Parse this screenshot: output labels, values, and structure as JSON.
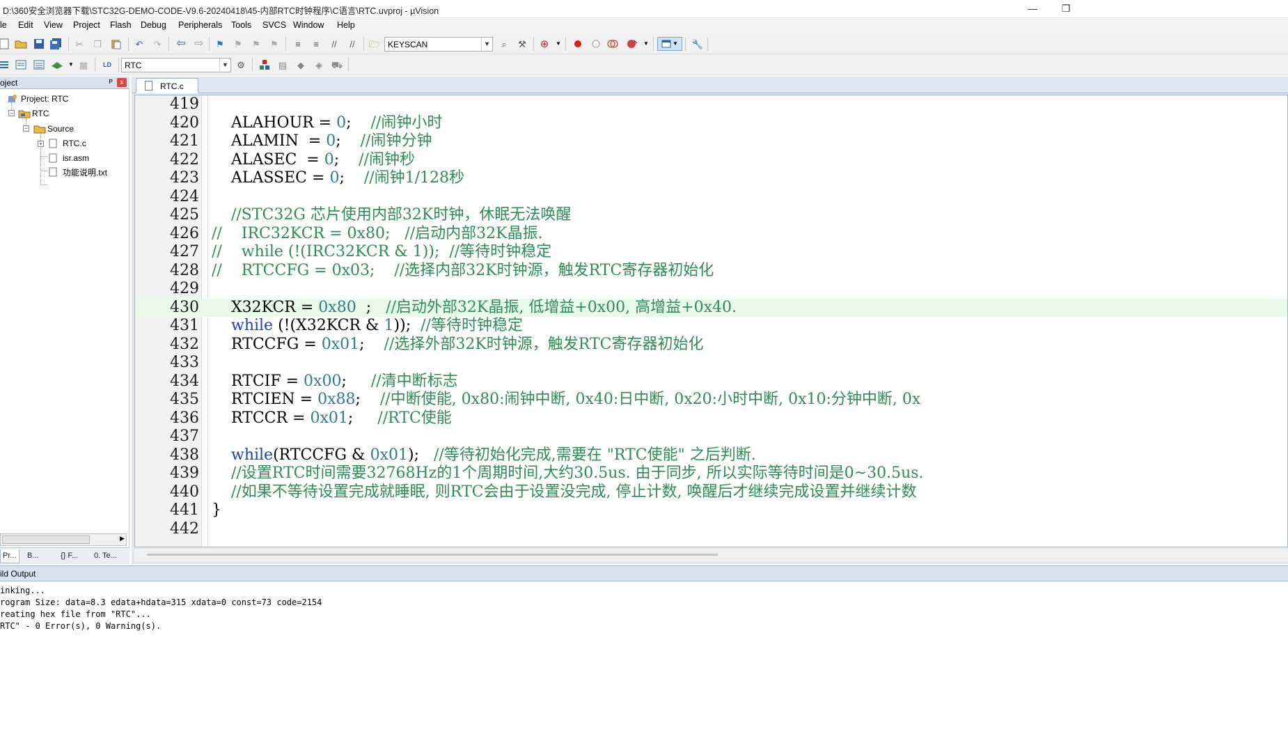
{
  "window": {
    "title": "D:\\360安全浏览器下载\\STC32G-DEMO-CODE-V9.6-20240418\\45-内部RTC时钟程序\\C语言\\RTC.uvproj - µVision",
    "minimize": "—",
    "restore": "❐"
  },
  "menu": [
    "le",
    "Edit",
    "View",
    "Project",
    "Flash",
    "Debug",
    "Peripherals",
    "Tools",
    "SVCS",
    "Window",
    "Help"
  ],
  "toolbar": {
    "find_combo": "KEYSCAN",
    "target_combo": "RTC"
  },
  "project_panel": {
    "title": "oject",
    "pin": "ᴘ",
    "close": "x",
    "root": "Project: RTC",
    "target": "RTC",
    "group": "Source",
    "files": [
      "RTC.c",
      "isr.asm",
      "功能说明.txt"
    ],
    "tabs": [
      "Pr...",
      "B...",
      "{} F...",
      "0. Te..."
    ]
  },
  "editor": {
    "tab": "RTC.c",
    "lines": [
      {
        "n": "419",
        "segs": []
      },
      {
        "n": "420",
        "segs": [
          [
            "t",
            "    ALAHOUR = "
          ],
          [
            "n",
            "0"
          ],
          [
            "t",
            ";    "
          ],
          [
            "c",
            "//闹钟小时"
          ]
        ]
      },
      {
        "n": "421",
        "segs": [
          [
            "t",
            "    ALAMIN  = "
          ],
          [
            "n",
            "0"
          ],
          [
            "t",
            ";    "
          ],
          [
            "c",
            "//闹钟分钟"
          ]
        ]
      },
      {
        "n": "422",
        "segs": [
          [
            "t",
            "    ALASEC  = "
          ],
          [
            "n",
            "0"
          ],
          [
            "t",
            ";    "
          ],
          [
            "c",
            "//闹钟秒"
          ]
        ]
      },
      {
        "n": "423",
        "segs": [
          [
            "t",
            "    ALASSEC = "
          ],
          [
            "n",
            "0"
          ],
          [
            "t",
            ";    "
          ],
          [
            "c",
            "//闹钟1/128秒"
          ]
        ]
      },
      {
        "n": "424",
        "segs": []
      },
      {
        "n": "425",
        "segs": [
          [
            "c",
            "    //STC32G 芯片使用内部32K时钟，休眠无法唤醒"
          ]
        ]
      },
      {
        "n": "426",
        "segs": [
          [
            "c",
            "//    IRC32KCR = 0x80;   //启动内部32K晶振."
          ]
        ]
      },
      {
        "n": "427",
        "segs": [
          [
            "c",
            "//    while (!(IRC32KCR & 1));  //等待时钟稳定"
          ]
        ]
      },
      {
        "n": "428",
        "segs": [
          [
            "c",
            "//    RTCCFG = 0x03;    //选择内部32K时钟源，触发RTC寄存器初始化"
          ]
        ]
      },
      {
        "n": "429",
        "segs": []
      },
      {
        "n": "430",
        "hl": true,
        "segs": [
          [
            "t",
            "    X32KCR = "
          ],
          [
            "n",
            "0x80"
          ],
          [
            "t",
            "  ;   "
          ],
          [
            "c",
            "//启动外部32K晶振, 低增益+0x00, 高增益+0x40."
          ]
        ]
      },
      {
        "n": "431",
        "segs": [
          [
            "t",
            "    "
          ],
          [
            "k",
            "while"
          ],
          [
            "t",
            " (!(X32KCR & "
          ],
          [
            "n",
            "1"
          ],
          [
            "t",
            "));  "
          ],
          [
            "c",
            "//等待时钟稳定"
          ]
        ]
      },
      {
        "n": "432",
        "segs": [
          [
            "t",
            "    RTCCFG = "
          ],
          [
            "n",
            "0x01"
          ],
          [
            "t",
            ";    "
          ],
          [
            "c",
            "//选择外部32K时钟源，触发RTC寄存器初始化"
          ]
        ]
      },
      {
        "n": "433",
        "segs": []
      },
      {
        "n": "434",
        "segs": [
          [
            "t",
            "    RTCIF = "
          ],
          [
            "n",
            "0x00"
          ],
          [
            "t",
            ";     "
          ],
          [
            "c",
            "//清中断标志"
          ]
        ]
      },
      {
        "n": "435",
        "segs": [
          [
            "t",
            "    RTCIEN = "
          ],
          [
            "n",
            "0x88"
          ],
          [
            "t",
            ";    "
          ],
          [
            "c",
            "//中断使能, 0x80:闹钟中断, 0x40:日中断, 0x20:小时中断, 0x10:分钟中断, 0x"
          ]
        ]
      },
      {
        "n": "436",
        "segs": [
          [
            "t",
            "    RTCCR = "
          ],
          [
            "n",
            "0x01"
          ],
          [
            "t",
            ";     "
          ],
          [
            "c",
            "//RTC使能"
          ]
        ]
      },
      {
        "n": "437",
        "segs": []
      },
      {
        "n": "438",
        "segs": [
          [
            "t",
            "    "
          ],
          [
            "k",
            "while"
          ],
          [
            "t",
            "(RTCCFG & "
          ],
          [
            "n",
            "0x01"
          ],
          [
            "t",
            ");   "
          ],
          [
            "c",
            "//等待初始化完成,需要在 \"RTC使能\" 之后判断."
          ]
        ]
      },
      {
        "n": "439",
        "segs": [
          [
            "c",
            "    //设置RTC时间需要32768Hz的1个周期时间,大约30.5us. 由于同步, 所以实际等待时间是0~30.5us."
          ]
        ]
      },
      {
        "n": "440",
        "segs": [
          [
            "c",
            "    //如果不等待设置完成就睡眠, 则RTC会由于设置没完成, 停止计数, 唤醒后才继续完成设置并继续计数"
          ]
        ]
      },
      {
        "n": "441",
        "segs": [
          [
            "t",
            "}"
          ]
        ]
      },
      {
        "n": "442",
        "segs": []
      }
    ]
  },
  "build_output": {
    "title": "ild Output",
    "lines": [
      "inking...",
      "rogram Size: data=8.3 edata+hdata=315 xdata=0 const=73 code=2154",
      "reating hex file from \"RTC\"...",
      "RTC\" - 0 Error(s), 0 Warning(s)."
    ]
  },
  "colors": {
    "number": "#2f7c8c",
    "keyword": "#1c3fbe",
    "comment": "#2e8b57",
    "current_line": "#e8fbe8"
  }
}
